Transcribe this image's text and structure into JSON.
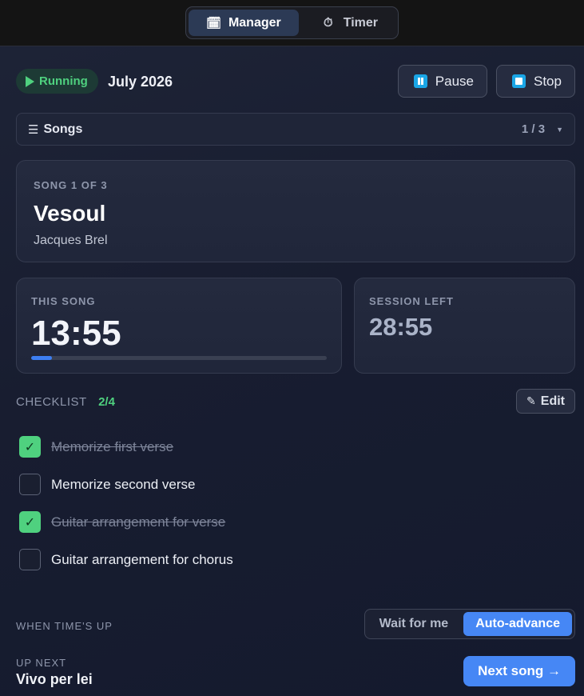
{
  "tabs": [
    {
      "label": "Manager",
      "icon": "calendar-icon",
      "active": true
    },
    {
      "label": "Timer",
      "icon": "stopwatch-icon",
      "active": false
    }
  ],
  "status": {
    "label": "Running",
    "color": "#4fd17f"
  },
  "month": "July 2026",
  "controls": {
    "pause_label": "Pause",
    "stop_label": "Stop"
  },
  "songs_bar": {
    "title": "Songs",
    "count": "1 / 3"
  },
  "current_song": {
    "eyebrow": "SONG 1 OF 3",
    "title": "Vesoul",
    "artist": "Jacques Brel"
  },
  "this_song": {
    "label": "THIS SONG",
    "time": "13:55",
    "progress": 0.07
  },
  "session": {
    "label": "SESSION LEFT",
    "time": "28:55"
  },
  "checklist": {
    "label": "CHECKLIST",
    "count": "2/4",
    "edit_label": "Edit",
    "items": [
      {
        "text": "Memorize first verse",
        "done": true
      },
      {
        "text": "Memorize second verse",
        "done": false
      },
      {
        "text": "Guitar arrangement for verse",
        "done": true
      },
      {
        "text": "Guitar arrangement for chorus",
        "done": false
      }
    ]
  },
  "when_time_up": {
    "label": "WHEN TIME'S UP",
    "options": [
      {
        "label": "Wait for me",
        "active": false
      },
      {
        "label": "Auto-advance",
        "active": true
      }
    ]
  },
  "up_next": {
    "label": "UP NEXT",
    "title": "Vivo per lei",
    "button_label": "Next song →"
  },
  "colors": {
    "accent": "#4687f5",
    "success": "#4fd17f",
    "background": "#181d30"
  }
}
